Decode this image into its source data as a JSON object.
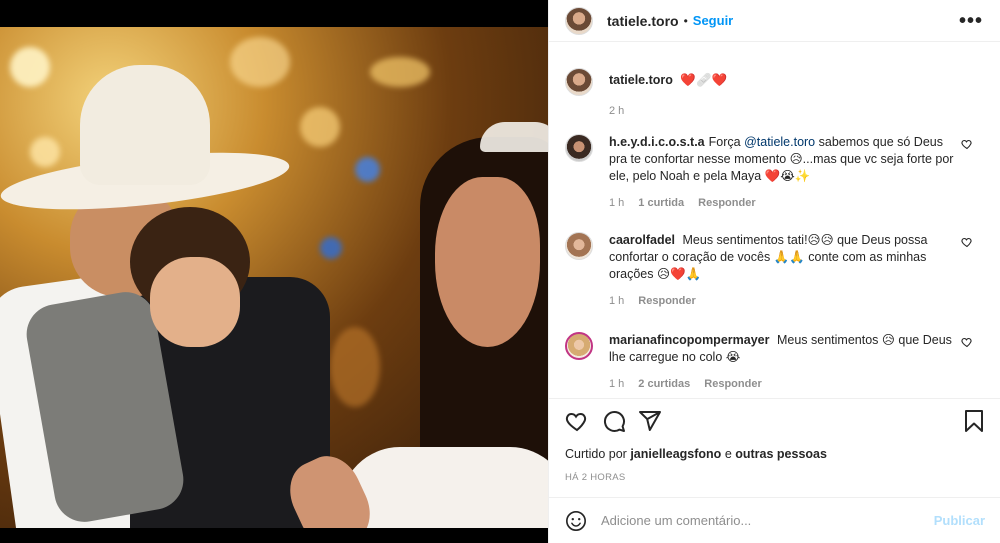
{
  "post": {
    "username": "tatiele.toro",
    "follow_label": "Seguir",
    "dot": "•",
    "more_label": "•••",
    "caption_username": "tatiele.toro",
    "caption_text": "❤️🩹❤️",
    "caption_time": "2 h"
  },
  "comments": [
    {
      "username": "h.e.y.d.i.c.o.s.t.a",
      "text_before": "Força ",
      "mention": "@tatiele.toro",
      "text_after": " sabemos que só Deus pra te confortar nesse momento 😥...mas que vc seja forte por ele, pelo Noah e pela Maya ❤️😭✨",
      "time": "1 h",
      "likes": "1 curtida",
      "reply": "Responder"
    },
    {
      "username": "caarolfadel",
      "text": "Meus sentimentos tati!😥😥 que Deus possa confortar o coração de vocês 🙏🙏 conte com as minhas orações 😥❤️🙏",
      "time": "1 h",
      "reply": "Responder"
    },
    {
      "username": "marianafincopompermayer",
      "text": "Meus sentimentos 😥 que Deus lhe carregue no colo 😭",
      "time": "1 h",
      "likes": "2 curtidas",
      "reply": "Responder"
    }
  ],
  "likes": {
    "prefix": "Curtido por",
    "user": "janielleagsfono",
    "suffix": "e",
    "others": "outras pessoas"
  },
  "timestamp": "Há 2 horas",
  "add_comment": {
    "placeholder": "Adicione um comentário...",
    "publish_label": "Publicar"
  },
  "icons": {
    "like": "heart-icon",
    "comment": "comment-icon",
    "share": "share-icon",
    "save": "bookmark-icon",
    "emoji": "emoji-icon",
    "more": "more-options-icon"
  },
  "colors": {
    "accent": "#0095f6",
    "publish_disabled": "#b2dffc",
    "muted": "#8e8e8e",
    "text": "#262626"
  }
}
